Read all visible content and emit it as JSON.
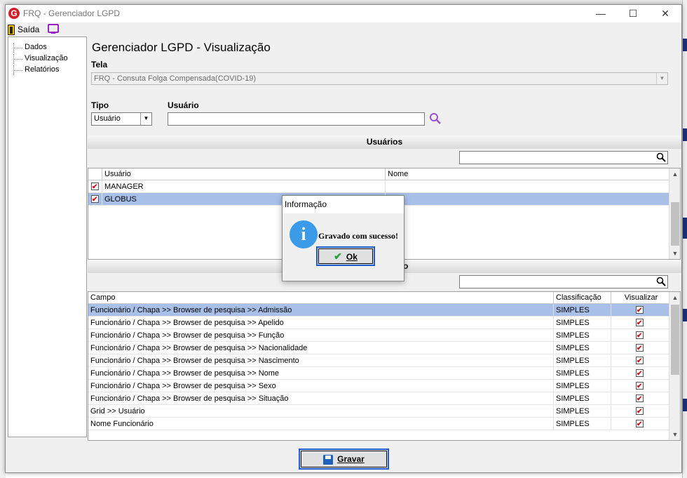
{
  "window": {
    "title": "FRQ - Gerenciador LGPD"
  },
  "toolbar": {
    "exit_label": "Saída"
  },
  "tree": {
    "items": [
      "Dados",
      "Visualização",
      "Relatórios"
    ]
  },
  "main": {
    "title": "Gerenciador LGPD - Visualização",
    "tela_label": "Tela",
    "tela_value": "FRQ - Consuta Folga Compensada(COVID-19)",
    "tipo_label": "Tipo",
    "tipo_value": "Usuário",
    "usuario_label": "Usuário",
    "usuario_value": "",
    "users_section_title": "Usuários",
    "users_grid": {
      "columns": [
        "Usuário",
        "Nome"
      ],
      "rows": [
        {
          "checked": true,
          "usuario": "MANAGER",
          "nome": "",
          "selected": false
        },
        {
          "checked": true,
          "usuario": "GLOBUS",
          "nome": "",
          "selected": true
        }
      ]
    },
    "fields_section_title": "o",
    "fields_grid": {
      "columns": [
        "Campo",
        "Classificação",
        "Visualizar"
      ],
      "rows": [
        {
          "campo": "Funcionário / Chapa >> Browser de pesquisa >> Admissão",
          "classificacao": "SIMPLES",
          "visualizar": true,
          "selected": true
        },
        {
          "campo": "Funcionário / Chapa >> Browser de pesquisa >> Apelido",
          "classificacao": "SIMPLES",
          "visualizar": true,
          "selected": false
        },
        {
          "campo": "Funcionário / Chapa >> Browser de pesquisa >> Função",
          "classificacao": "SIMPLES",
          "visualizar": true,
          "selected": false
        },
        {
          "campo": "Funcionário / Chapa >> Browser de pesquisa >> Nacionalidade",
          "classificacao": "SIMPLES",
          "visualizar": true,
          "selected": false
        },
        {
          "campo": "Funcionário / Chapa >> Browser de pesquisa >> Nascimento",
          "classificacao": "SIMPLES",
          "visualizar": true,
          "selected": false
        },
        {
          "campo": "Funcionário / Chapa >> Browser de pesquisa >> Nome",
          "classificacao": "SIMPLES",
          "visualizar": true,
          "selected": false
        },
        {
          "campo": "Funcionário / Chapa >> Browser de pesquisa >> Sexo",
          "classificacao": "SIMPLES",
          "visualizar": true,
          "selected": false
        },
        {
          "campo": "Funcionário / Chapa >> Browser de pesquisa >> Situação",
          "classificacao": "SIMPLES",
          "visualizar": true,
          "selected": false
        },
        {
          "campo": "Grid >> Usuário",
          "classificacao": "SIMPLES",
          "visualizar": true,
          "selected": false
        },
        {
          "campo": "Nome Funcionário",
          "classificacao": "SIMPLES",
          "visualizar": true,
          "selected": false
        }
      ]
    },
    "save_label": "Gravar"
  },
  "dialog": {
    "title": "Informação",
    "message": "Gravado com sucesso!",
    "ok_label": "Ok"
  },
  "colors": {
    "selection": "#a8bfe8",
    "accent": "#1f5bd1",
    "check": "#d4141d",
    "brand": "#d0202a"
  }
}
